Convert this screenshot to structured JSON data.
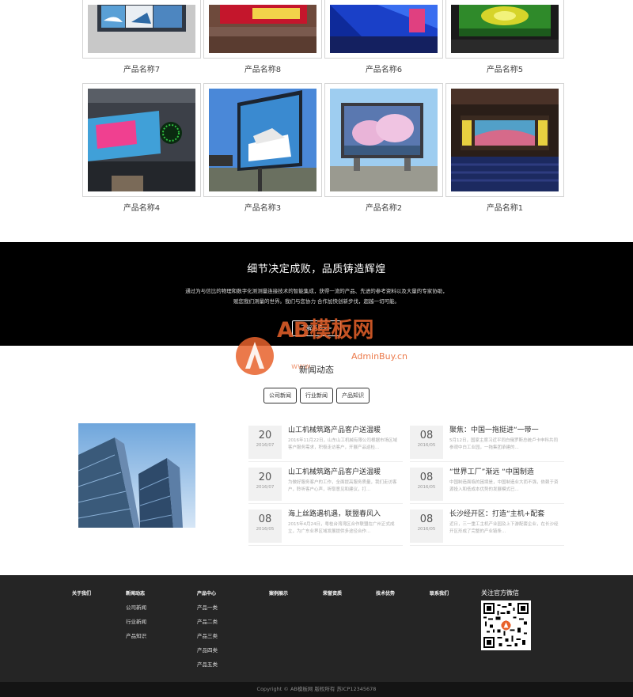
{
  "products_row1": [
    {
      "name": "产品名称7"
    },
    {
      "name": "产品名称8"
    },
    {
      "name": "产品名称6"
    },
    {
      "name": "产品名称5"
    }
  ],
  "products_row2": [
    {
      "name": "产品名称4"
    },
    {
      "name": "产品名称3"
    },
    {
      "name": "产品名称2"
    },
    {
      "name": "产品名称1"
    }
  ],
  "banner": {
    "title": "细节决定成败，品质铸造辉煌",
    "line1": "通过为与信比的物理和数字化测测量连接技术的智能集成，获得一流的产品、先进的参考资料以及大量的专家协助，",
    "line2": "赋您我们测量的世界。我们与您协力 合作加快创新步伐，超越一切可能。",
    "button": "了解更多>>"
  },
  "watermark": {
    "brand": "AB模板网",
    "url": "AdminBuy.cn",
    "www": "www."
  },
  "news": {
    "title": "新闻动态",
    "tabs": [
      "公司新闻",
      "行业新闻",
      "产品知识"
    ],
    "left": [
      {
        "day": "20",
        "ym": "2016/07",
        "title": "山工机械筑路产品客户送温暖",
        "summary": "2016年11月22日，山东山工机械有限公司根据市场区域客户服务需求，积极走访客户，开展产品巡检..."
      },
      {
        "day": "20",
        "ym": "2016/07",
        "title": "山工机械筑路产品客户送温暖",
        "summary": "为做好服务客户的工作，全面提高服务质量，我们走访客户，聆听客户心声，听取意见和建议，打..."
      },
      {
        "day": "08",
        "ym": "2016/05",
        "title": "海上丝路遇机遇，联盟春风入",
        "summary": "2015年4月24日，粤桂台湾湾区合作联盟在广州正式成立，为广东业界区域发展提供多途径合作..."
      }
    ],
    "right": [
      {
        "day": "08",
        "ym": "2016/05",
        "title": "聚焦：中国一拖挺进“一带一",
        "summary": "5月12日，国家主席习近平同白俄罗斯总统卢卡申科共同参观中白工业园，一拖集团承建的..."
      },
      {
        "day": "08",
        "ym": "2016/05",
        "title": "“世界工厂”渐远 “中国制造",
        "summary": "中国制造面临的困境是，中国制造业大而不强，依赖于资源投入和低成本优势的发展模式已..."
      },
      {
        "day": "08",
        "ym": "2016/05",
        "title": "长沙经开区：打造“主机+配套",
        "summary": "近日，三一重工主机产业园及上下游配套企业，在长沙经开区形成了完整的产业链条..."
      }
    ]
  },
  "footer": {
    "cols": [
      {
        "heading": "关于我们",
        "links": []
      },
      {
        "heading": "新闻动态",
        "links": [
          "公司新闻",
          "行业新闻",
          "产品知识"
        ]
      },
      {
        "heading": "产品中心",
        "links": [
          "产品一类",
          "产品二类",
          "产品三类",
          "产品四类",
          "产品五类"
        ]
      },
      {
        "heading": "案例展示",
        "links": []
      },
      {
        "heading": "荣誉资质",
        "links": []
      },
      {
        "heading": "技术优势",
        "links": []
      },
      {
        "heading": "联系我们",
        "links": []
      }
    ],
    "qr_title": "关注官方微信",
    "copyright": "Copyright © AB模板网 版权所有  苏ICP12345678"
  },
  "colors": {
    "banner_bg": "#000000",
    "footer_bg": "#252525",
    "copyright_bg": "#141414",
    "watermark_orange": "#e8622b"
  }
}
